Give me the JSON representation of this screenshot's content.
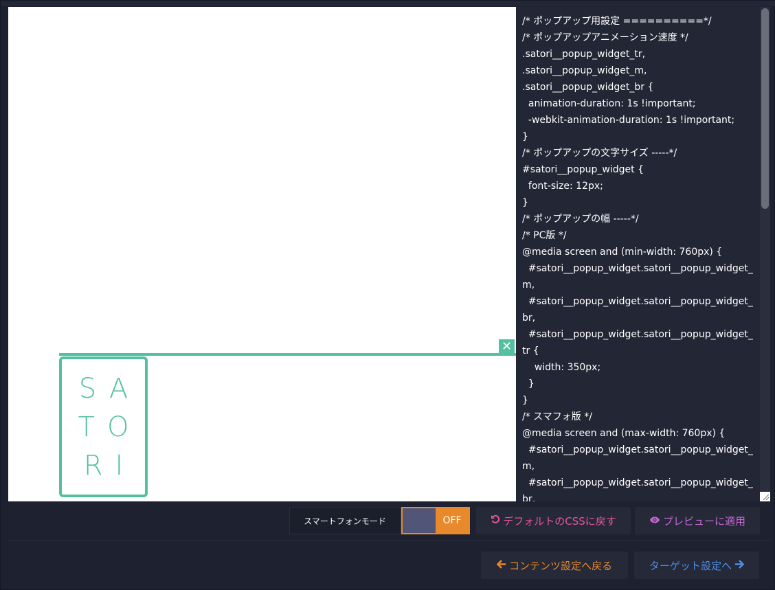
{
  "preview": {
    "popup_logo_lines": [
      "SA",
      "TO",
      "RI"
    ],
    "close_symbol": "✕",
    "accent_color": "#55c0a0"
  },
  "editor": {
    "css_code": "/* ポップアップ用設定 ==========*/\n/* ポップアップアニメーション速度 */\n.satori__popup_widget_tr,\n.satori__popup_widget_m,\n.satori__popup_widget_br {\n  animation-duration: 1s !important;\n  -webkit-animation-duration: 1s !important;\n}\n/* ポップアップの文字サイズ -----*/\n#satori__popup_widget {\n  font-size: 12px;\n}\n/* ポップアップの幅 -----*/\n/* PC版 */\n@media screen and (min-width: 760px) {\n  #satori__popup_widget.satori__popup_widget_m,\n  #satori__popup_widget.satori__popup_widget_br,\n  #satori__popup_widget.satori__popup_widget_tr {\n    width: 350px;\n  }\n}\n/* スマフォ版 */\n@media screen and (max-width: 760px) {\n  #satori__popup_widget.satori__popup_widget_m,\n  #satori__popup_widget.satori__popup_widget_br,"
  },
  "toolbar": {
    "smartphone_mode_label": "スマートフォンモード",
    "toggle_state": "OFF",
    "reset_css_label": "デフォルトのCSSに戻す",
    "reset_icon": "undo-icon",
    "apply_preview_label": "プレビューに適用",
    "preview_icon": "eye-icon"
  },
  "footer": {
    "back_label": "コンテンツ設定へ戻る",
    "back_icon": "arrow-left-icon",
    "next_label": "ターゲット設定へ",
    "next_icon": "arrow-right-icon"
  },
  "colors": {
    "orange": "#e8892b",
    "pink": "#e8559c",
    "purple": "#c86ad8",
    "blue": "#4d8ee8"
  }
}
